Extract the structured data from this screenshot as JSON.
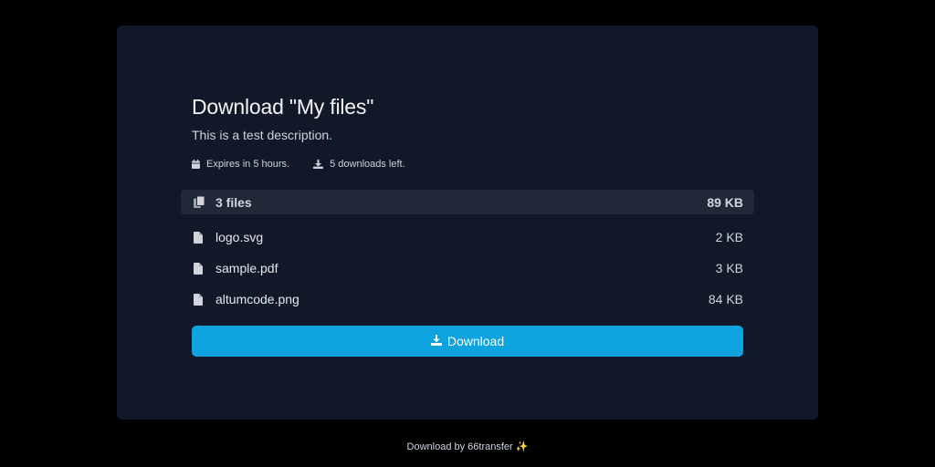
{
  "page": {
    "title": "Download \"My files\"",
    "description": "This is a test description."
  },
  "meta": {
    "expires": "Expires in 5 hours.",
    "downloads_left": "5 downloads left.",
    "expires_icon": "calendar-icon",
    "downloads_icon": "download-icon"
  },
  "summary": {
    "label": "3 files",
    "total_size": "89 KB",
    "icon": "files-icon"
  },
  "files": [
    {
      "name": "logo.svg",
      "size": "2 KB",
      "icon": "file-icon"
    },
    {
      "name": "sample.pdf",
      "size": "3 KB",
      "icon": "file-icon"
    },
    {
      "name": "altumcode.png",
      "size": "84 KB",
      "icon": "file-icon"
    }
  ],
  "actions": {
    "download_label": "Download"
  },
  "footer": {
    "text": "Download by 66transfer",
    "emoji": "✨"
  },
  "colors": {
    "page_bg": "#000000",
    "card_bg": "#111827",
    "summary_bg": "#1f2937",
    "accent": "#0ea2de"
  }
}
